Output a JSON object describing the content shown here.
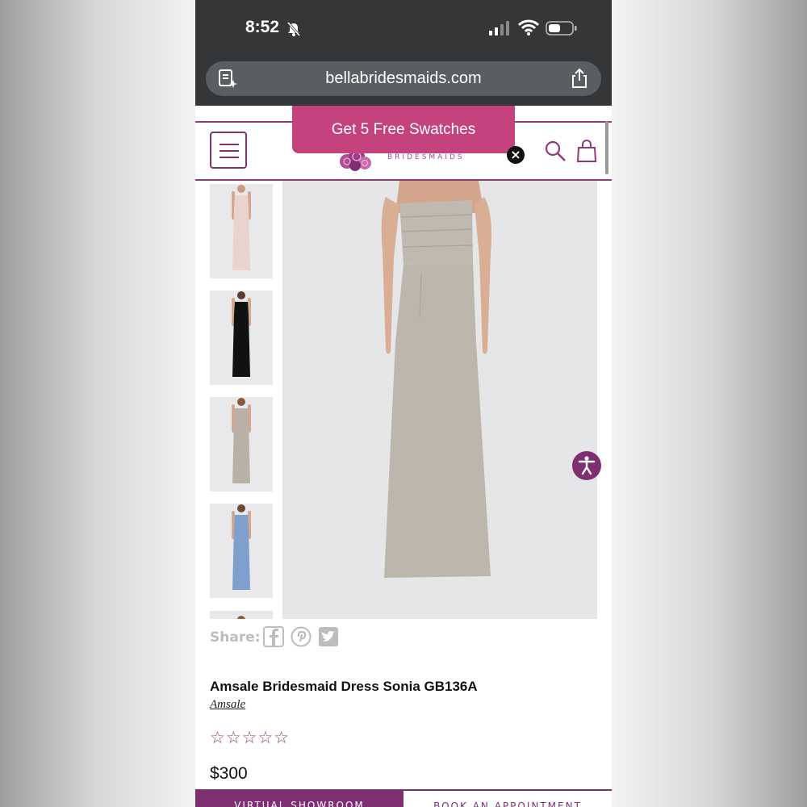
{
  "status_bar": {
    "time": "8:52"
  },
  "browser": {
    "url": "bellabridesmaids.com"
  },
  "promo": {
    "label": "Get 5 Free Swatches"
  },
  "logo": {
    "text": "BRIDESMAIDS"
  },
  "gallery": {
    "thumbnails": [
      {
        "color": "pink-dress",
        "dress_hex": "#e8d3cf"
      },
      {
        "color": "black-dress",
        "dress_hex": "#111111"
      },
      {
        "color": "taupe-dress",
        "dress_hex": "#b9b1a6"
      },
      {
        "color": "blue-dress",
        "dress_hex": "#7f9fcd"
      }
    ],
    "main_dress_hex": "#bcb6ad"
  },
  "share": {
    "label": "Share:"
  },
  "product": {
    "title": "Amsale Bridesmaid Dress Sonia GB136A",
    "brand": "Amsale",
    "rating_stars": "☆☆☆☆☆",
    "price": "$300"
  },
  "bottom_bar": {
    "showroom_label": "VIRTUAL SHOWROOM",
    "appointment_label": "BOOK AN APPOINTMENT"
  },
  "colors": {
    "accent": "#8e3a7d",
    "promo": "#c4437f"
  }
}
